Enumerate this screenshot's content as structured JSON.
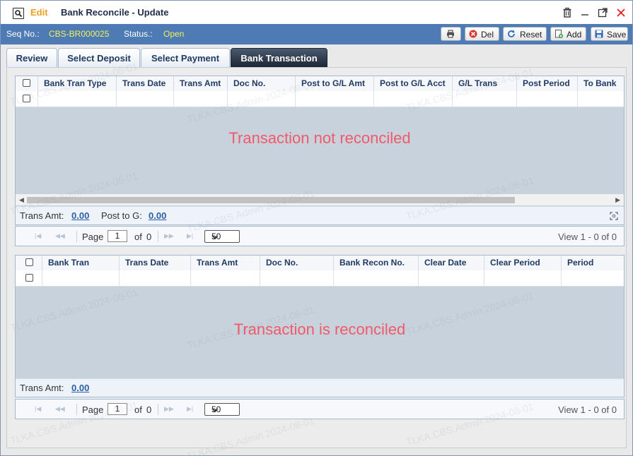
{
  "title": {
    "mode": "Edit",
    "text": "Bank Reconcile - Update"
  },
  "info": {
    "seq_label": "Seq No.:",
    "seq_value": "CBS-BR000025",
    "status_label": "Status.:",
    "status_value": "Open"
  },
  "toolbar": {
    "del": "Del",
    "reset": "Reset",
    "add": "Add",
    "save": "Save"
  },
  "tabs": [
    {
      "label": "Review"
    },
    {
      "label": "Select Deposit"
    },
    {
      "label": "Select Payment"
    },
    {
      "label": "Bank Transaction"
    }
  ],
  "grid1": {
    "columns": [
      "Bank Tran Type",
      "Trans Date",
      "Trans Amt",
      "Doc No.",
      "Post to G/L Amt",
      "Post to G/L Acct",
      "G/L Trans",
      "Post Period",
      "To Bank"
    ],
    "empty_message": "Transaction not reconciled",
    "summary": {
      "trans_amt_label": "Trans Amt:",
      "trans_amt_value": "0.00",
      "post_label": "Post to G:",
      "post_value": "0.00"
    }
  },
  "grid2": {
    "columns": [
      "Bank Tran",
      "Trans Date",
      "Trans Amt",
      "Doc No.",
      "Bank Recon No.",
      "Clear Date",
      "Clear Period",
      "Period"
    ],
    "empty_message": "Transaction is reconciled",
    "summary": {
      "trans_amt_label": "Trans Amt:",
      "trans_amt_value": "0.00"
    }
  },
  "pager": {
    "page_label": "Page",
    "page_value": "1",
    "of_label": "of",
    "total_pages": "0",
    "page_size": "50",
    "view_text": "View  1 - 0  of 0"
  },
  "watermark": "TLKA.CBS.Admin 2024-08-01",
  "colors": {
    "accent": "#4e7bb4",
    "status": "#f1f15a",
    "empty_msg": "#f05a6a",
    "mode": "#f0a020"
  }
}
